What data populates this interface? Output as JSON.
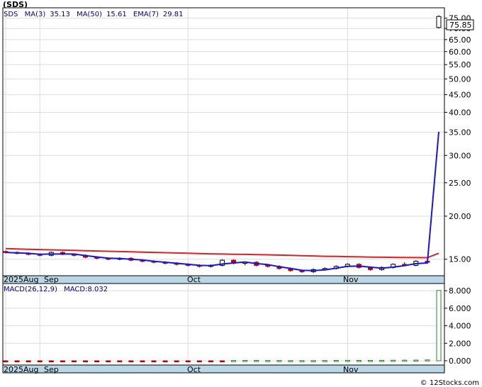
{
  "ticker": "(SDS)",
  "legend": {
    "symbol": "SDS",
    "ma3_label": "MA(3)",
    "ma3_value": "35.13",
    "ma50_label": "MA(50)",
    "ma50_value": "15.61",
    "ema7_label": "EMA(7)",
    "ema7_value": "29.81"
  },
  "price_tag": "75.85",
  "macd_legend": {
    "label": "MACD(26,12,9)",
    "macd_label": "MACD:8.032"
  },
  "credit": "© 12Stocks.com",
  "colors": {
    "background": "#ffffff",
    "axis_band": "#b9d7e6",
    "grid": "#dcdcdc",
    "ma_blue": "#1515e6",
    "ma_red": "#e02020",
    "up": "#228b22",
    "down": "#c00000"
  },
  "chart_data": [
    {
      "type": "candlestick",
      "title": "(SDS)",
      "log_scale": true,
      "ylim": [
        13.5,
        80
      ],
      "y_ticks": [
        "15.00",
        "20.00",
        "25.00",
        "30.00",
        "35.00",
        "40.00",
        "45.00",
        "50.00",
        "55.00",
        "60.00",
        "65.00",
        "70.00",
        "75.00"
      ],
      "x_tick_labels": [
        "2025Aug",
        "Sep",
        "Oct",
        "Nov"
      ],
      "grid": true,
      "last_price": 75.85,
      "candles": [
        {
          "o": 15.8,
          "h": 15.9,
          "l": 15.6,
          "c": 15.7
        },
        {
          "o": 15.7,
          "h": 15.8,
          "l": 15.5,
          "c": 15.6
        },
        {
          "o": 15.6,
          "h": 15.7,
          "l": 15.4,
          "c": 15.5
        },
        {
          "o": 15.5,
          "h": 15.6,
          "l": 15.3,
          "c": 15.4
        },
        {
          "o": 15.4,
          "h": 15.8,
          "l": 15.3,
          "c": 15.7
        },
        {
          "o": 15.7,
          "h": 15.8,
          "l": 15.4,
          "c": 15.5
        },
        {
          "o": 15.5,
          "h": 15.6,
          "l": 15.3,
          "c": 15.4
        },
        {
          "o": 15.4,
          "h": 15.5,
          "l": 15.1,
          "c": 15.2
        },
        {
          "o": 15.2,
          "h": 15.3,
          "l": 15.0,
          "c": 15.1
        },
        {
          "o": 15.1,
          "h": 15.2,
          "l": 14.9,
          "c": 15.0
        },
        {
          "o": 15.0,
          "h": 15.2,
          "l": 14.9,
          "c": 15.1
        },
        {
          "o": 15.1,
          "h": 15.2,
          "l": 14.8,
          "c": 14.9
        },
        {
          "o": 14.9,
          "h": 15.0,
          "l": 14.7,
          "c": 14.8
        },
        {
          "o": 14.8,
          "h": 14.9,
          "l": 14.6,
          "c": 14.7
        },
        {
          "o": 14.7,
          "h": 14.8,
          "l": 14.5,
          "c": 14.6
        },
        {
          "o": 14.6,
          "h": 14.7,
          "l": 14.4,
          "c": 14.5
        },
        {
          "o": 14.5,
          "h": 14.6,
          "l": 14.3,
          "c": 14.4
        },
        {
          "o": 14.4,
          "h": 14.5,
          "l": 14.2,
          "c": 14.3
        },
        {
          "o": 14.3,
          "h": 14.5,
          "l": 14.2,
          "c": 14.4
        },
        {
          "o": 14.4,
          "h": 15.0,
          "l": 14.3,
          "c": 14.9
        },
        {
          "o": 14.9,
          "h": 15.0,
          "l": 14.5,
          "c": 14.6
        },
        {
          "o": 14.6,
          "h": 14.8,
          "l": 14.4,
          "c": 14.7
        },
        {
          "o": 14.7,
          "h": 14.8,
          "l": 14.3,
          "c": 14.4
        },
        {
          "o": 14.4,
          "h": 14.5,
          "l": 14.2,
          "c": 14.3
        },
        {
          "o": 14.3,
          "h": 14.4,
          "l": 14.0,
          "c": 14.1
        },
        {
          "o": 14.1,
          "h": 14.2,
          "l": 13.8,
          "c": 13.9
        },
        {
          "o": 13.9,
          "h": 14.0,
          "l": 13.7,
          "c": 13.8
        },
        {
          "o": 13.8,
          "h": 14.1,
          "l": 13.7,
          "c": 14.0
        },
        {
          "o": 14.0,
          "h": 14.2,
          "l": 13.9,
          "c": 14.1
        },
        {
          "o": 14.1,
          "h": 14.4,
          "l": 14.0,
          "c": 14.3
        },
        {
          "o": 14.3,
          "h": 14.6,
          "l": 14.2,
          "c": 14.5
        },
        {
          "o": 14.5,
          "h": 14.6,
          "l": 14.1,
          "c": 14.2
        },
        {
          "o": 14.2,
          "h": 14.3,
          "l": 13.9,
          "c": 14.0
        },
        {
          "o": 14.0,
          "h": 14.3,
          "l": 13.9,
          "c": 14.2
        },
        {
          "o": 14.2,
          "h": 14.6,
          "l": 14.1,
          "c": 14.5
        },
        {
          "o": 14.5,
          "h": 14.7,
          "l": 14.3,
          "c": 14.4
        },
        {
          "o": 14.4,
          "h": 14.9,
          "l": 14.3,
          "c": 14.8
        },
        {
          "o": 14.8,
          "h": 15.0,
          "l": 14.6,
          "c": 14.7
        },
        {
          "o": 70.5,
          "h": 76.5,
          "l": 70.0,
          "c": 75.85
        }
      ],
      "ma3": [
        15.7,
        15.65,
        15.6,
        15.5,
        15.53,
        15.53,
        15.53,
        15.37,
        15.23,
        15.1,
        15.07,
        15.0,
        14.93,
        14.8,
        14.7,
        14.6,
        14.5,
        14.4,
        14.37,
        14.53,
        14.63,
        14.73,
        14.57,
        14.47,
        14.27,
        14.1,
        13.93,
        13.9,
        13.97,
        14.13,
        14.3,
        14.33,
        14.23,
        14.13,
        14.23,
        14.37,
        14.57,
        14.63,
        35.13
      ],
      "ma50": [
        16.1,
        16.06,
        16.03,
        16.0,
        15.97,
        15.94,
        15.91,
        15.88,
        15.85,
        15.82,
        15.79,
        15.76,
        15.73,
        15.7,
        15.67,
        15.64,
        15.61,
        15.58,
        15.55,
        15.53,
        15.51,
        15.49,
        15.47,
        15.45,
        15.42,
        15.39,
        15.36,
        15.33,
        15.3,
        15.28,
        15.26,
        15.24,
        15.22,
        15.2,
        15.19,
        15.18,
        15.17,
        15.16,
        15.61
      ],
      "ema7": [
        15.8,
        15.75,
        15.7,
        15.63,
        15.65,
        15.62,
        15.57,
        15.47,
        15.38,
        15.29,
        15.24,
        15.15,
        15.06,
        14.97,
        14.88,
        14.79,
        14.7,
        14.6,
        14.55,
        14.64,
        14.63,
        14.65,
        14.59,
        14.52,
        14.41,
        14.28,
        14.16,
        14.12,
        14.11,
        14.16,
        14.25,
        14.24,
        14.18,
        14.19,
        14.27,
        14.3,
        14.42,
        14.49,
        29.81
      ]
    },
    {
      "type": "bar",
      "title": "MACD(26,12,9)",
      "ylim": [
        0,
        8.5
      ],
      "y_ticks": [
        "0.000",
        "2.000",
        "4.000",
        "6.000",
        "8.000"
      ],
      "x_tick_labels": [
        "2025Aug",
        "Sep",
        "Oct",
        "Nov"
      ],
      "values": [
        -0.02,
        -0.02,
        -0.02,
        -0.02,
        -0.02,
        -0.02,
        -0.02,
        -0.02,
        -0.02,
        -0.02,
        -0.02,
        -0.02,
        -0.02,
        -0.02,
        -0.02,
        -0.02,
        -0.02,
        -0.02,
        -0.02,
        -0.02,
        0.03,
        0.04,
        0.04,
        0.03,
        0.03,
        0.02,
        0.02,
        0.02,
        0.03,
        0.04,
        0.05,
        0.04,
        0.04,
        0.05,
        0.06,
        0.07,
        0.08,
        0.1,
        8.032
      ]
    }
  ]
}
